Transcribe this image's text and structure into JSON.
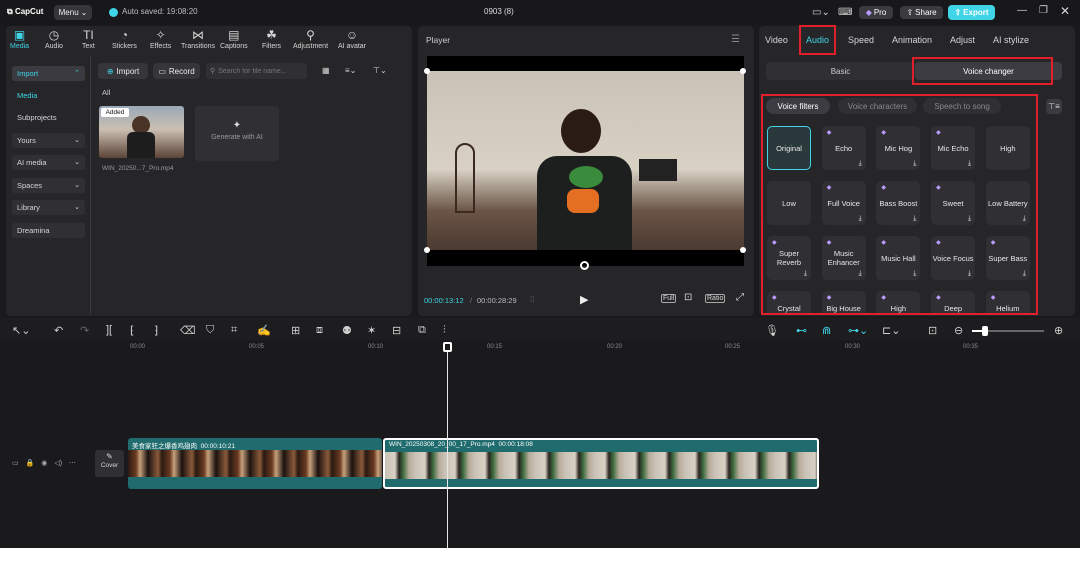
{
  "topbar": {
    "logo": "CapCut",
    "menu": "Menu",
    "autosave": "Auto saved: 19:08:20",
    "project_title": "0903 (8)",
    "pro": "Pro",
    "share": "Share",
    "export": "Export"
  },
  "media_tabs": [
    {
      "label": "Media",
      "icon": "▣"
    },
    {
      "label": "Audio",
      "icon": "◷"
    },
    {
      "label": "Text",
      "icon": "TI"
    },
    {
      "label": "Stickers",
      "icon": "◔"
    },
    {
      "label": "Effects",
      "icon": "✧"
    },
    {
      "label": "Transitions",
      "icon": "⋈"
    },
    {
      "label": "Captions",
      "icon": "▤"
    },
    {
      "label": "Filters",
      "icon": "☘"
    },
    {
      "label": "Adjustment",
      "icon": "⚲"
    },
    {
      "label": "AI avatar",
      "icon": "☺"
    }
  ],
  "sidebar": {
    "items": [
      {
        "label": "Import",
        "chevron": "^"
      },
      {
        "label": "Media"
      },
      {
        "label": "Subprojects"
      },
      {
        "label": "Yours",
        "chevron": "v"
      },
      {
        "label": "AI media",
        "chevron": "v"
      },
      {
        "label": "Spaces",
        "chevron": "v"
      },
      {
        "label": "Library",
        "chevron": "v"
      },
      {
        "label": "Dreamina"
      }
    ]
  },
  "media": {
    "import_btn": "Import",
    "record_btn": "Record",
    "search_placeholder": "Search for file name...",
    "filter_all": "All",
    "clip_badge": "Added",
    "clip_name": "WIN_20250...7_Pro.mp4",
    "generate_ai": "Generate with AI"
  },
  "player": {
    "title": "Player",
    "time_current": "00:00:13:12",
    "time_total": "00:00:28:29",
    "full": "Full",
    "ratio": "Ratio"
  },
  "right": {
    "tabs": [
      "Video",
      "Audio",
      "Speed",
      "Animation",
      "Adjust",
      "AI stylize"
    ],
    "subtabs": [
      "Basic",
      "Voice changer"
    ],
    "filter_tabs": [
      "Voice filters",
      "Voice characters",
      "Speech to song"
    ],
    "effects": [
      {
        "label": "Original",
        "pro": false,
        "dl": false
      },
      {
        "label": "Echo",
        "pro": true,
        "dl": true
      },
      {
        "label": "Mic Hog",
        "pro": true,
        "dl": true
      },
      {
        "label": "Mic Echo",
        "pro": true,
        "dl": true
      },
      {
        "label": "High",
        "pro": false,
        "dl": false
      },
      {
        "label": "Low",
        "pro": false,
        "dl": false
      },
      {
        "label": "Full Voice",
        "pro": true,
        "dl": true
      },
      {
        "label": "Bass Boost",
        "pro": true,
        "dl": true
      },
      {
        "label": "Sweet",
        "pro": true,
        "dl": true
      },
      {
        "label": "Low Battery",
        "pro": false,
        "dl": true
      },
      {
        "label": "Super Reverb",
        "pro": true,
        "dl": true
      },
      {
        "label": "Music Enhancer",
        "pro": true,
        "dl": true
      },
      {
        "label": "Music Hall",
        "pro": true,
        "dl": true
      },
      {
        "label": "Voice Focus",
        "pro": true,
        "dl": true
      },
      {
        "label": "Super Bass",
        "pro": true,
        "dl": true
      },
      {
        "label": "Crystal",
        "pro": true,
        "dl": false
      },
      {
        "label": "Big House",
        "pro": true,
        "dl": false
      },
      {
        "label": "High",
        "pro": true,
        "dl": false
      },
      {
        "label": "Deep",
        "pro": true,
        "dl": false
      },
      {
        "label": "Helium",
        "pro": true,
        "dl": false
      }
    ]
  },
  "timeline": {
    "ticks": [
      "00:00",
      "00:05",
      "00:10",
      "00:15",
      "00:20",
      "00:25",
      "00:30",
      "00:35"
    ],
    "cover": "Cover",
    "clip1": {
      "name": "美食家狂之爆香鸡翅肉",
      "duration": "00:00:10:21"
    },
    "clip2": {
      "name": "WIN_20250308_20_00_17_Pro.mp4",
      "duration": "00:00:18:08"
    }
  },
  "colors": {
    "accent": "#3fd5e6",
    "highlight": "#e0202a",
    "clip_bg": "#1f6b6d"
  }
}
